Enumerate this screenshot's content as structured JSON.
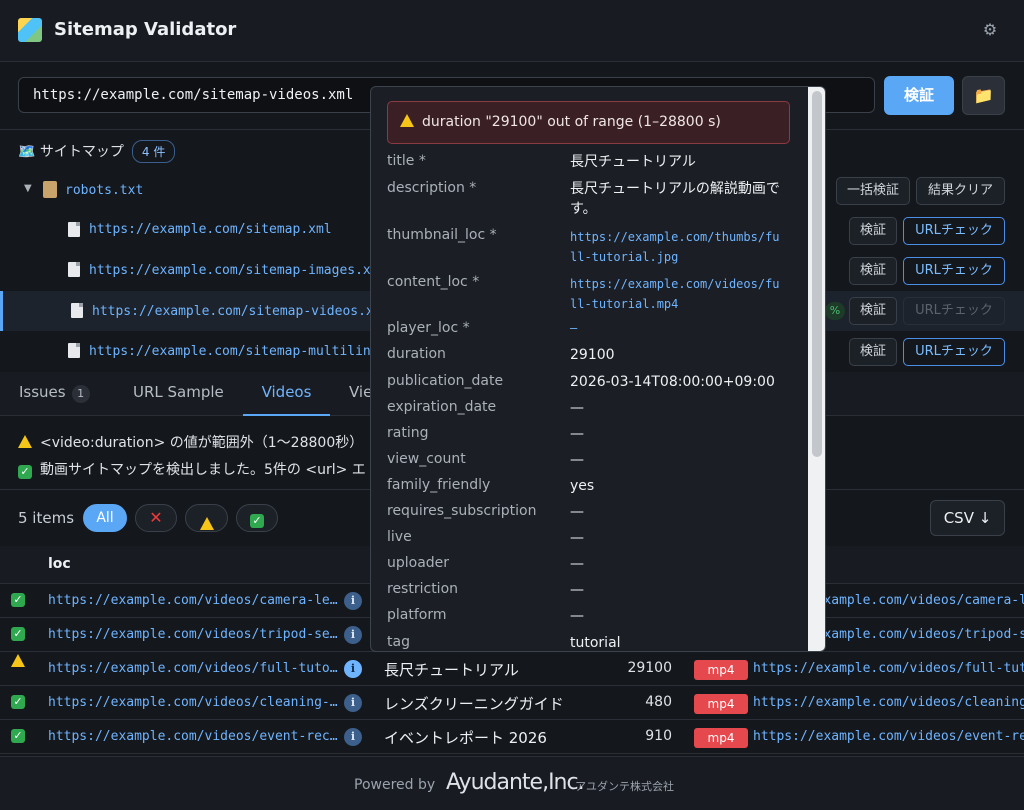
{
  "app": {
    "title": "Sitemap Validator",
    "settings_icon": "gear-icon"
  },
  "urlbar": {
    "value": "https://example.com/sitemap-videos.xml",
    "validate_label": "検証",
    "folder_icon": "folder-icon"
  },
  "tree": {
    "heading": "🗺️ サイトマップ",
    "count": "4 件",
    "root": {
      "label": "robots.txt",
      "bulk_label": "一括検証",
      "clear_label": "結果クリア"
    },
    "items": [
      {
        "url": "https://example.com/sitemap.xml",
        "validate": "検証",
        "urlcheck": "URLチェック",
        "selected": false
      },
      {
        "url": "https://example.com/sitemap-images.xml",
        "validate": "検証",
        "urlcheck": "URLチェック",
        "selected": false
      },
      {
        "url": "https://example.com/sitemap-videos.xml",
        "validate": "検証",
        "urlcheck": "URLチェック",
        "selected": true
      },
      {
        "url": "https://example.com/sitemap-multilingual.xml",
        "validate": "検証",
        "urlcheck": "URLチェック",
        "selected": false
      }
    ]
  },
  "tabs": [
    {
      "label": "Issues",
      "badge": "1"
    },
    {
      "label": "URL Sample"
    },
    {
      "label": "Videos",
      "active": true
    },
    {
      "label": "Vie"
    }
  ],
  "messages": [
    {
      "type": "warning",
      "text": "<video:duration> の値が範囲外（1〜28800秒）"
    },
    {
      "type": "ok",
      "text": "動画サイトマップを検出しました。5件の <url> エ"
    }
  ],
  "filter": {
    "count": "5 items",
    "all_label": "All",
    "csv_label": "CSV ↓"
  },
  "table": {
    "col_loc": "loc",
    "rows": [
      {
        "status": "ok",
        "loc": "https://example.com/videos/camera-le…",
        "title": "",
        "duration": "",
        "format": "",
        "content": "https://example.com/videos/camera-le"
      },
      {
        "status": "ok",
        "loc": "https://example.com/videos/tripod-se…",
        "title": "",
        "duration": "",
        "format": "",
        "content": "https://example.com/videos/tripod-se"
      },
      {
        "status": "warning",
        "loc": "https://example.com/videos/full-tuto…",
        "title": "長尺チュートリアル",
        "duration": "29100",
        "format": "mp4",
        "content": "https://example.com/videos/full-tuto"
      },
      {
        "status": "ok",
        "loc": "https://example.com/videos/cleaning-…",
        "title": "レンズクリーニングガイド",
        "duration": "480",
        "format": "mp4",
        "content": "https://example.com/videos/cleaning-"
      },
      {
        "status": "ok",
        "loc": "https://example.com/videos/event-rec…",
        "title": "イベントレポート 2026",
        "duration": "910",
        "format": "mp4",
        "content": "https://example.com/videos/event-rec"
      }
    ]
  },
  "popup": {
    "error": "duration \"29100\" out of range (1–28800 s)",
    "fields": [
      {
        "key": "title *",
        "value": "長尺チュートリアル"
      },
      {
        "key": "description *",
        "value": "長尺チュートリアルの解説動画です。"
      },
      {
        "key": "thumbnail_loc *",
        "value": "https://example.com/thumbs/full-tutorial.jpg",
        "link": true
      },
      {
        "key": "content_loc *",
        "value": "https://example.com/videos/full-tutorial.mp4",
        "link": true
      },
      {
        "key": "player_loc *",
        "value": "—",
        "link": true
      },
      {
        "key": "duration",
        "value": "29100"
      },
      {
        "key": "publication_date",
        "value": "2026-03-14T08:00:00+09:00"
      },
      {
        "key": "expiration_date",
        "value": "—"
      },
      {
        "key": "rating",
        "value": "—"
      },
      {
        "key": "view_count",
        "value": "—"
      },
      {
        "key": "family_friendly",
        "value": "yes"
      },
      {
        "key": "requires_subscription",
        "value": "—"
      },
      {
        "key": "live",
        "value": "—"
      },
      {
        "key": "uploader",
        "value": "—"
      },
      {
        "key": "restriction",
        "value": "—"
      },
      {
        "key": "platform",
        "value": "—"
      },
      {
        "key": "tag",
        "value": "tutorial"
      }
    ]
  },
  "footer": {
    "powered": "Powered by",
    "brand": "Ayudante,Inc.",
    "brand_jp": "アユダンテ株式会社"
  }
}
